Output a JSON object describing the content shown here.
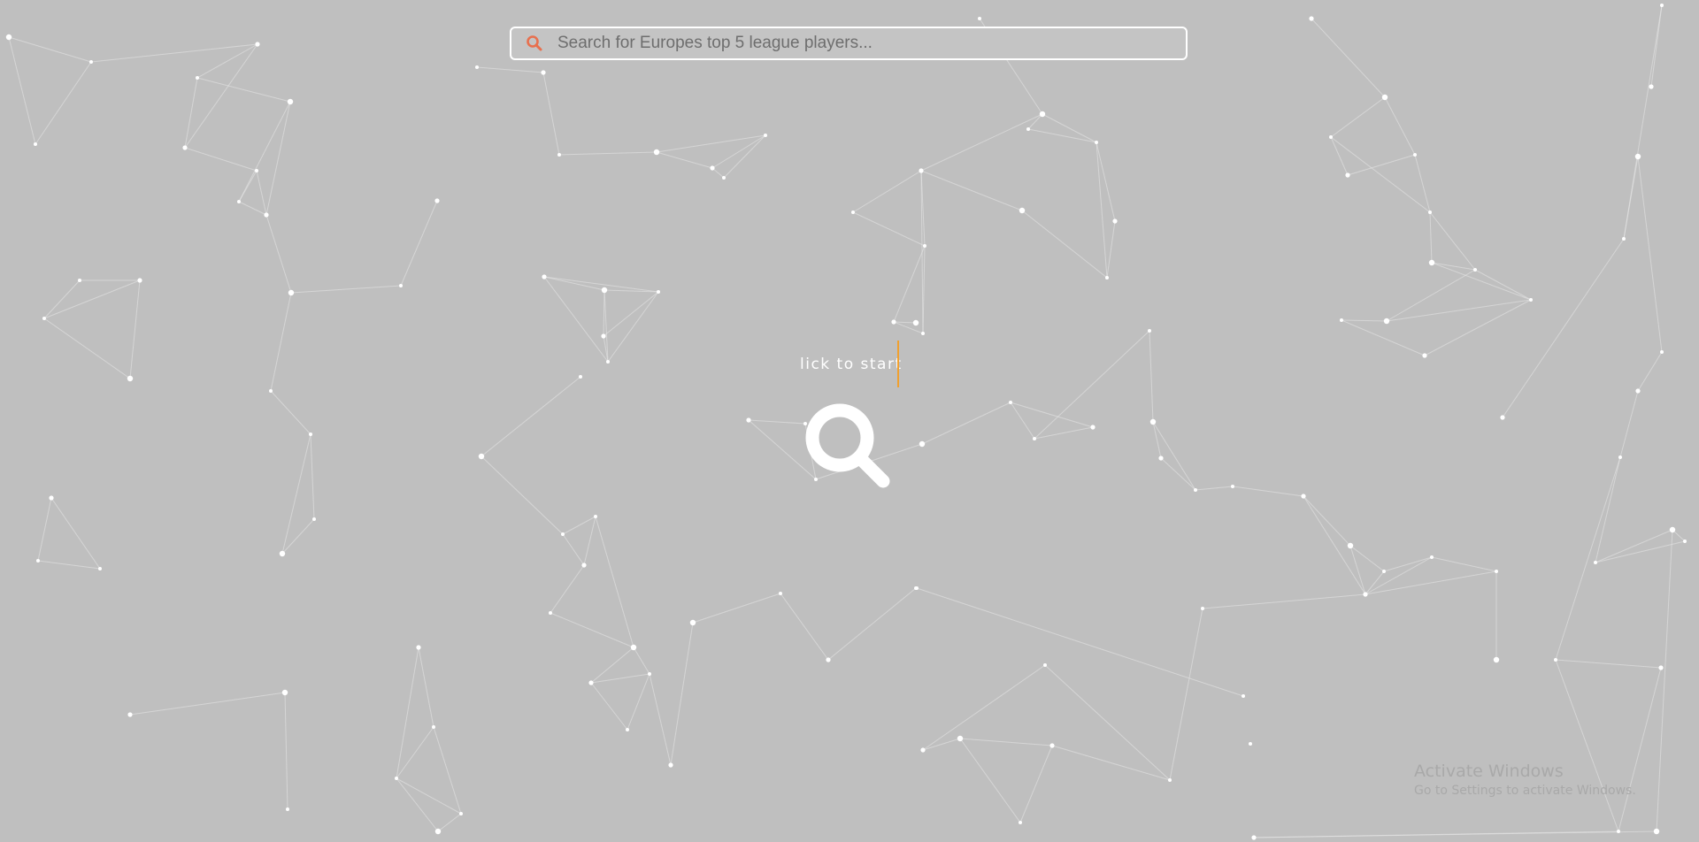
{
  "search": {
    "placeholder": "Search for Europes top 5 league players...",
    "icon": "search-icon",
    "icon_color": "#e8704e"
  },
  "hero": {
    "typing_text": "lick to start",
    "caret_color": "#f0a030",
    "button_icon": "search-icon"
  },
  "watermark": {
    "title": "Activate Windows",
    "subtitle": "Go to Settings to activate Windows."
  },
  "colors": {
    "background": "#bfbfbf",
    "nodes": "#ffffff",
    "links": "#e8e8e8"
  }
}
